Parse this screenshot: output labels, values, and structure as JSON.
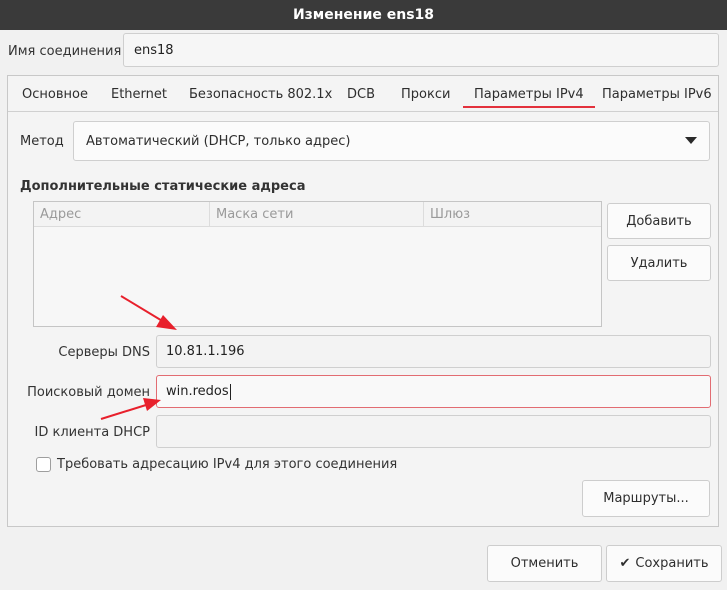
{
  "window": {
    "title": "Изменение ens18"
  },
  "connection": {
    "label": "Имя соединения",
    "value": "ens18"
  },
  "tabs": [
    {
      "label": "Основное",
      "active": false
    },
    {
      "label": "Ethernet",
      "active": false
    },
    {
      "label": "Безопасность 802.1x",
      "active": false
    },
    {
      "label": "DCB",
      "active": false
    },
    {
      "label": "Прокси",
      "active": false
    },
    {
      "label": "Параметры IPv4",
      "active": true
    },
    {
      "label": "Параметры IPv6",
      "active": false
    }
  ],
  "ipv4": {
    "method_label": "Метод",
    "method_value": "Автоматический (DHCP, только адрес)",
    "static_title": "Дополнительные статические адреса",
    "columns": [
      "Адрес",
      "Маска сети",
      "Шлюз"
    ],
    "rows": [],
    "add_label": "Добавить",
    "delete_label": "Удалить",
    "dns_label": "Серверы DNS",
    "dns_value": "10.81.1.196",
    "search_label": "Поисковый домен",
    "search_value": "win.redos",
    "dhcp_label": "ID клиента DHCP",
    "dhcp_value": "",
    "require_label": "Требовать адресацию IPv4 для этого соединения",
    "require_checked": false,
    "routes_label": "Маршруты..."
  },
  "footer": {
    "cancel_label": "Отменить",
    "save_label": "Сохранить"
  },
  "colors": {
    "accent": "#e3313c",
    "titlebar": "#3a3a3a",
    "arrow": "#e8202c"
  },
  "icons": {
    "save": "check-icon",
    "method": "chevron-down-icon"
  }
}
